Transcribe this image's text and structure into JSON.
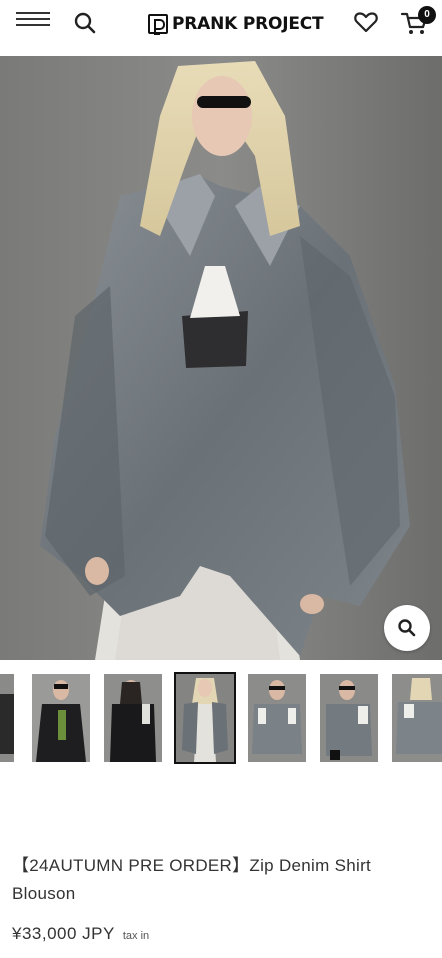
{
  "header": {
    "brand_name": "PRANK PROJECT",
    "cart_count": "0"
  },
  "icons": [
    "menu-icon",
    "search-icon",
    "brand-logo-icon",
    "heart-icon",
    "cart-icon",
    "zoom-icon"
  ],
  "gallery": {
    "active_index": 3,
    "thumb_count": 7
  },
  "product": {
    "title": "【24AUTUMN PRE ORDER】Zip Denim Shirt Blouson",
    "price": "¥33,000 JPY",
    "tax_note": "tax in"
  },
  "colors": {
    "text": "#333333",
    "accent": "#111111",
    "photo_background": "#7d7d7b",
    "denim": "#6e7478"
  }
}
